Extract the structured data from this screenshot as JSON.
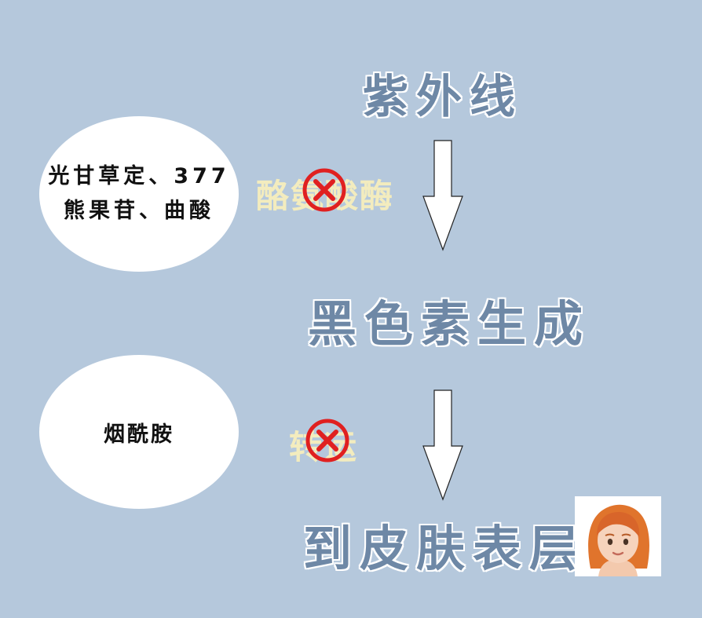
{
  "steps": {
    "uv": "紫外线",
    "melanin": "黑色素生成",
    "skin": "到皮肤表层"
  },
  "inhibitors": {
    "tyrosinase_blockers": {
      "line1": "光甘草定、377",
      "line2": "熊果苷、曲酸"
    },
    "transport_blocker": "烟酰胺"
  },
  "blocked_labels": {
    "enzyme": "酪氨酸酶",
    "transport": "转运"
  },
  "icons": {
    "block": "red-x-circle-icon",
    "avatar": "woman-red-hair-emoji"
  },
  "colors": {
    "background": "#b5c8dc",
    "step_text": "#6e88a6",
    "blocked_text": "#f3ecbe",
    "x_mark": "#e02020"
  }
}
